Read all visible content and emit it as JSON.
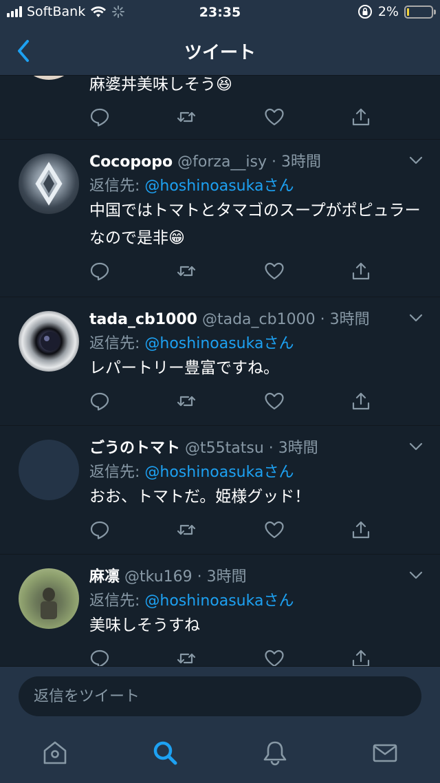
{
  "status_bar": {
    "carrier": "SoftBank",
    "time": "23:35",
    "battery_percent": "2%",
    "battery_level": 0.02
  },
  "nav": {
    "title": "ツイート",
    "back_icon": "chevron-left-icon"
  },
  "partial_tweet": {
    "text": "麻婆丼美味しそう😆"
  },
  "tweets": [
    {
      "display_name": "Cocopopo",
      "handle": "@forza__isy",
      "time": "3時間",
      "reply_prefix": "返信先: ",
      "reply_to": "@hoshinoasukaさん",
      "text": "中国ではトマトとタマゴのスープがポピュラーなので是非😁"
    },
    {
      "display_name": "tada_cb1000",
      "handle": "@tada_cb1000",
      "time": "3時間",
      "reply_prefix": "返信先: ",
      "reply_to": "@hoshinoasukaさん",
      "text": "レパートリー豊富ですね。"
    },
    {
      "display_name": "ごうのトマト",
      "handle": "@t55tatsu",
      "time": "3時間",
      "reply_prefix": "返信先: ",
      "reply_to": "@hoshinoasukaさん",
      "text": "おお、トマトだ。姫様グッド！"
    },
    {
      "display_name": "麻凛",
      "handle": "@tku169",
      "time": "3時間",
      "reply_prefix": "返信先: ",
      "reply_to": "@hoshinoasukaさん",
      "text": "美味しそうすね"
    }
  ],
  "separator": "·",
  "reply_composer": {
    "placeholder": "返信をツイート"
  },
  "tab_bar": {
    "items": [
      "home-icon",
      "search-icon",
      "notifications-icon",
      "messages-icon"
    ],
    "active": "search-icon"
  },
  "colors": {
    "background": "#15202b",
    "bar": "#243447",
    "accent": "#1da1f2",
    "secondary_text": "#8899a6"
  }
}
